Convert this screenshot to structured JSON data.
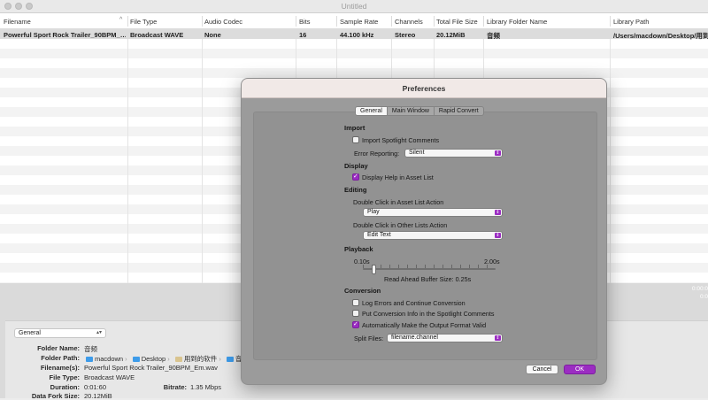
{
  "window": {
    "title": "Untitled"
  },
  "table": {
    "columns": [
      "Filename",
      "File Type",
      "Audio Codec",
      "Bits",
      "Sample Rate",
      "Channels",
      "Total File Size",
      "Library Folder Name",
      "Library Path"
    ],
    "sort_indicator": "^",
    "rows": [
      [
        "Powerful Sport Rock Trailer_90BPM_…",
        "Broadcast WAVE",
        "None",
        "16",
        "44.100 kHz",
        "Stereo",
        "20.12MiB",
        "音频",
        "/Users/macdown/Desktop/用到"
      ]
    ]
  },
  "lower_panel": {
    "view_select": "General",
    "fields": {
      "folder_name_label": "Folder Name:",
      "folder_name": "音频",
      "folder_path_label": "Folder Path:",
      "folder_path": [
        "macdown",
        "Desktop",
        "用到的软件",
        "音"
      ],
      "filenames_label": "Filename(s):",
      "filenames": "Powerful Sport Rock Trailer_90BPM_Em.wav",
      "file_type_label": "File Type:",
      "file_type": "Broadcast WAVE",
      "duration_label": "Duration:",
      "duration": "0:01:60",
      "bitrate_label": "Bitrate:",
      "bitrate": "1.35 Mbps",
      "data_fork_label": "Data Fork Size:",
      "data_fork": "20.12MiB"
    },
    "time_readout": [
      "0:00:0",
      "0:0"
    ]
  },
  "preferences": {
    "title": "Preferences",
    "tabs": [
      "General",
      "Main Window",
      "Rapid Convert"
    ],
    "active_tab": "General",
    "import": {
      "heading": "Import",
      "import_spotlight": {
        "label": "Import Spotlight Comments",
        "checked": false
      },
      "error_reporting_label": "Error Reporting:",
      "error_reporting_value": "Silent"
    },
    "display": {
      "heading": "Display",
      "help": {
        "label": "Display Help in Asset List",
        "checked": true
      }
    },
    "editing": {
      "heading": "Editing",
      "asset_list_action_label": "Double Click in Asset List Action",
      "asset_list_action_value": "Play",
      "other_lists_action_label": "Double Click in Other Lists Action",
      "other_lists_action_value": "Edit Text"
    },
    "playback": {
      "heading": "Playback",
      "min_label": "0.10s",
      "max_label": "2.00s",
      "buffer_label": "Read Ahead Buffer Size: 0.25s",
      "buffer_seconds": 0.25,
      "min_seconds": 0.1,
      "max_seconds": 2.0
    },
    "conversion": {
      "heading": "Conversion",
      "log_errors": {
        "label": "Log Errors and Continue Conversion",
        "checked": false
      },
      "put_info": {
        "label": "Put Conversion Info in the Spotlight Comments",
        "checked": false
      },
      "auto_valid": {
        "label": "Automatically Make the Output Format Valid",
        "checked": true
      },
      "split_files_label": "Split Files:",
      "split_files_value": "filename.channel"
    },
    "buttons": {
      "cancel": "Cancel",
      "ok": "OK"
    }
  }
}
